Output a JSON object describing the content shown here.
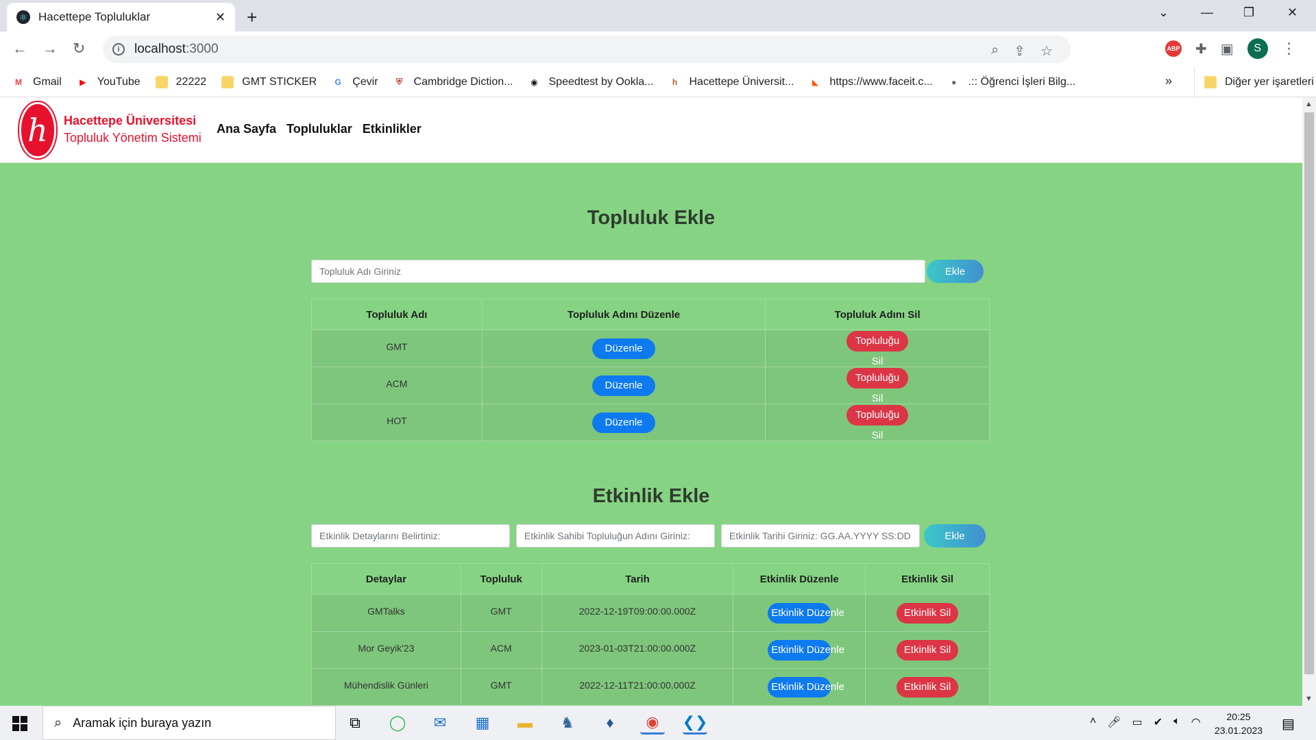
{
  "browser": {
    "tab_title": "Hacettepe Topluluklar",
    "tab_favicon": "react-icon",
    "new_tab": "+",
    "url_host": "localhost",
    "url_port": ":3000",
    "profile_initial": "S",
    "abp_label": "ABP",
    "bookmarks": [
      {
        "label": "Gmail",
        "icon": "gmail-icon",
        "color": "#ea4335",
        "glyph": "M"
      },
      {
        "label": "YouTube",
        "icon": "youtube-icon",
        "color": "#ff0000",
        "glyph": "▶"
      },
      {
        "label": "22222",
        "icon": "folder-icon",
        "color": "#f8d568",
        "glyph": ""
      },
      {
        "label": "GMT STICKER",
        "icon": "folder-icon",
        "color": "#f8d568",
        "glyph": ""
      },
      {
        "label": "Çevir",
        "icon": "google-translate-icon",
        "color": "#4285f4",
        "glyph": "G"
      },
      {
        "label": "Cambridge Diction...",
        "icon": "cambridge-icon",
        "color": "#c0392b",
        "glyph": "⛨"
      },
      {
        "label": "Speedtest by Ookla...",
        "icon": "speedtest-icon",
        "color": "#111111",
        "glyph": "◉"
      },
      {
        "label": "Hacettepe Üniversit...",
        "icon": "hacettepe-icon",
        "color": "#b25c2a",
        "glyph": "h"
      },
      {
        "label": "https://www.faceit.c...",
        "icon": "faceit-icon",
        "color": "#ff5500",
        "glyph": "◣"
      },
      {
        "label": ".:: Öğrenci İşleri Bilg...",
        "icon": "globe-icon",
        "color": "#5f6368",
        "glyph": "●"
      }
    ],
    "bookmarks_more": "»",
    "other_bookmarks": "Diğer yer işaretleri"
  },
  "site": {
    "brand_line1": "Hacettepe Üniversitesi",
    "brand_line2": "Topluluk Yönetim Sistemi",
    "nav": [
      "Ana Sayfa",
      "Topluluklar",
      "Etkinlikler"
    ]
  },
  "community_section": {
    "title": "Topluluk Ekle",
    "input_placeholder": "Topluluk Adı Giriniz",
    "add_button": "Ekle",
    "columns": [
      "Topluluk Adı",
      "Topluluk Adını Düzenle",
      "Topluluk Adını Sil"
    ],
    "rows": [
      {
        "name": "GMT",
        "edit": "Düzenle",
        "delete": "Topluluğu Sil"
      },
      {
        "name": "ACM",
        "edit": "Düzenle",
        "delete": "Topluluğu Sil"
      },
      {
        "name": "HOT",
        "edit": "Düzenle",
        "delete": "Topluluğu Sil"
      }
    ]
  },
  "event_section": {
    "title": "Etkinlik Ekle",
    "detail_placeholder": "Etkinlik Detaylarını Belirtiniz:",
    "owner_placeholder": "Etkinlik Sahibi Topluluğun Adını Giriniz:",
    "date_placeholder": "Etkinlik Tarihi Giriniz: GG.AA.YYYY SS:DD",
    "add_button": "Ekle",
    "columns": [
      "Detaylar",
      "Topluluk",
      "Tarih",
      "Etkinlik Düzenle",
      "Etkinlik Sil"
    ],
    "rows": [
      {
        "detail": "GMTalks",
        "community": "GMT",
        "date": "2022-12-19T09:00:00.000Z",
        "edit_a": "Etkinlik Düzen",
        "edit_b": "le",
        "delete": "Etkinlik Sil"
      },
      {
        "detail": "Mor Geyik'23",
        "community": "ACM",
        "date": "2023-01-03T21:00:00.000Z",
        "edit_a": "Etkinlik Düzen",
        "edit_b": "le",
        "delete": "Etkinlik Sil"
      },
      {
        "detail": "Mühendislik Günleri",
        "community": "GMT",
        "date": "2022-12-11T21:00:00.000Z",
        "edit_a": "Etkinlik Düzen",
        "edit_b": "le",
        "delete": "Etkinlik Sil"
      }
    ]
  },
  "taskbar": {
    "search_text": "Aramak için buraya yazın",
    "time": "20:25",
    "date": "23.01.2023"
  },
  "colors": {
    "page_bg": "#86d483",
    "brand_red": "#e8112d",
    "edit_blue": "#0d7af0",
    "delete_red": "#dc3545"
  }
}
